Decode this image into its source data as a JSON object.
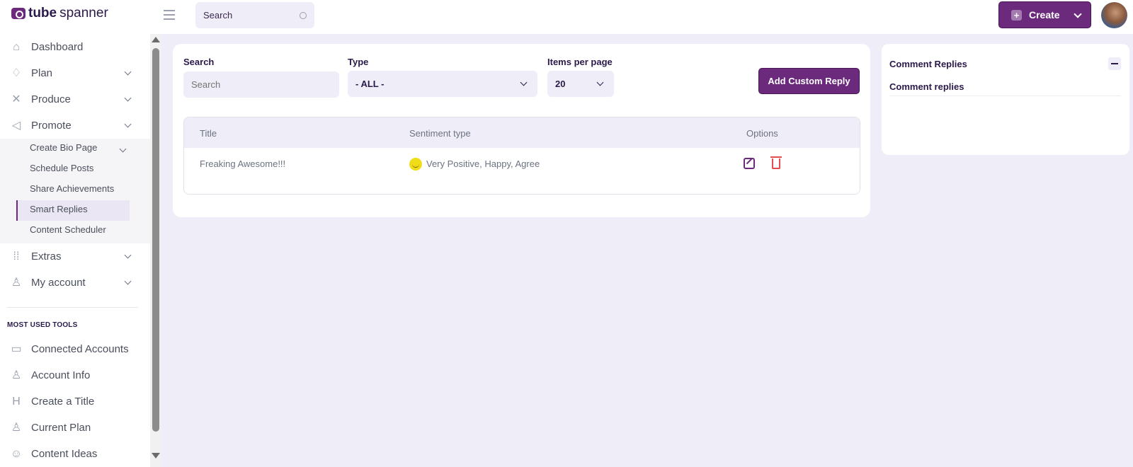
{
  "app": {
    "logo_bold": "tube",
    "logo_light": "spanner"
  },
  "topbar": {
    "search_label": "Search",
    "create_label": "Create"
  },
  "sidebar": {
    "items": [
      {
        "label": "Dashboard"
      },
      {
        "label": "Plan"
      },
      {
        "label": "Produce"
      },
      {
        "label": "Promote"
      }
    ],
    "sub_items": [
      {
        "label": "Create Bio Page"
      },
      {
        "label": "Schedule Posts"
      },
      {
        "label": "Share Achievements"
      },
      {
        "label": "Smart Replies"
      },
      {
        "label": "Content Scheduler"
      }
    ],
    "items_after": [
      {
        "label": "Extras"
      },
      {
        "label": "My account"
      }
    ],
    "tools_heading": "MOST USED TOOLS",
    "tools": [
      {
        "label": "Connected Accounts"
      },
      {
        "label": "Account Info"
      },
      {
        "label": "Create a Title"
      },
      {
        "label": "Current Plan"
      },
      {
        "label": "Content Ideas"
      }
    ]
  },
  "filters": {
    "search_label": "Search",
    "search_placeholder": "Search",
    "type_label": "Type",
    "type_value": "- ALL -",
    "per_page_label": "Items per page",
    "per_page_value": "20",
    "add_button": "Add Custom Reply"
  },
  "table": {
    "columns": [
      "Title",
      "Sentiment type",
      "Options"
    ],
    "rows": [
      {
        "title": "Freaking Awesome!!!",
        "sentiment": "Very Positive, Happy, Agree"
      }
    ]
  },
  "panel": {
    "title": "Comment Replies",
    "subtitle": "Comment replies"
  },
  "colors": {
    "brand": "#6b2a7c",
    "background": "#efedf8",
    "delete": "#e24c4c",
    "smiley": "#f0dc18"
  }
}
